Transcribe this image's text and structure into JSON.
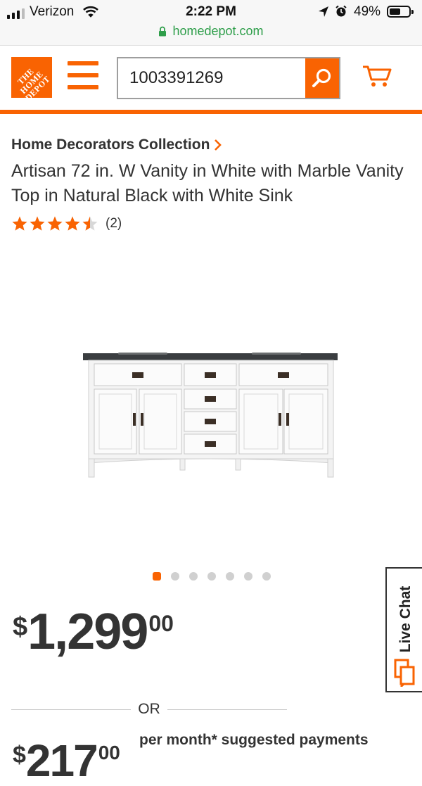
{
  "status_bar": {
    "carrier": "Verizon",
    "time": "2:22 PM",
    "battery": "49%"
  },
  "browser": {
    "url": "homedepot.com"
  },
  "header": {
    "logo_text": "THE HOME DEPOT",
    "search_value": "1003391269"
  },
  "product": {
    "brand": "Home Decorators Collection",
    "title": "Artisan 72 in. W Vanity in White with Marble Vanity Top in Natural Black with White Sink",
    "rating": 4.5,
    "review_count": "(2)"
  },
  "carousel": {
    "total": 7,
    "active_index": 0
  },
  "price": {
    "currency": "$",
    "whole": "1,299",
    "cents": "00"
  },
  "or_label": "OR",
  "financing": {
    "currency": "$",
    "whole": "217",
    "cents": "00",
    "text": "per month* suggested payments"
  },
  "live_chat": {
    "label": "Live Chat"
  },
  "colors": {
    "accent": "#f96302",
    "text": "#333333",
    "url_green": "#2e9e4a"
  }
}
